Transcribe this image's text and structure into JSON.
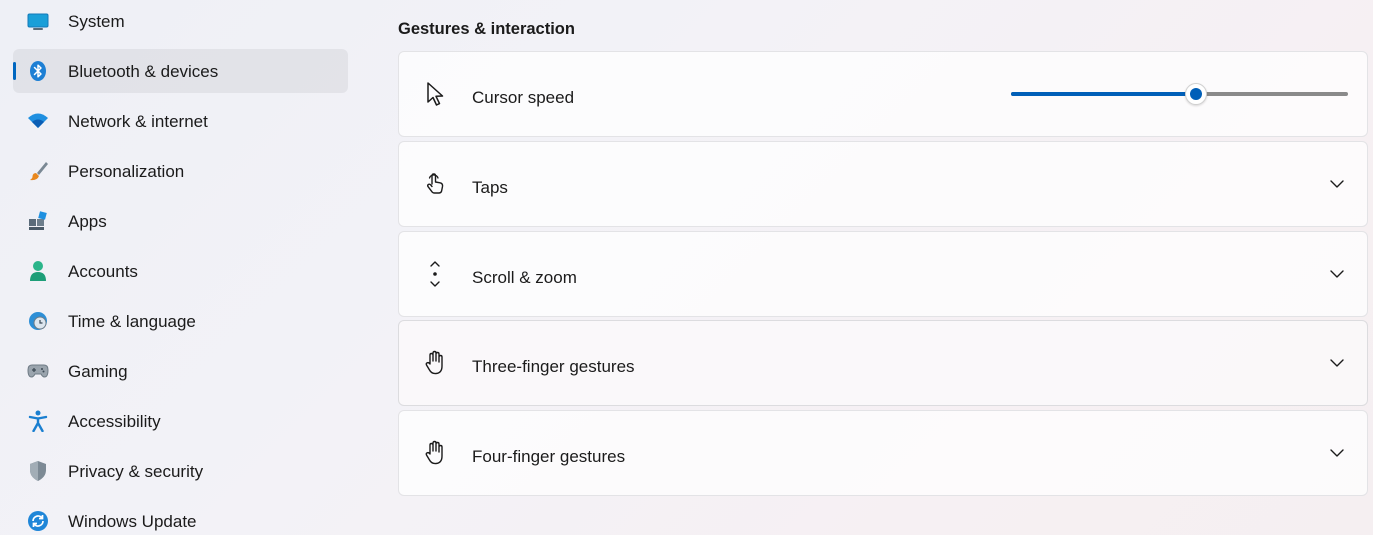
{
  "sidebar": {
    "items": [
      {
        "label": "System",
        "icon": "system-icon",
        "selected": false
      },
      {
        "label": "Bluetooth & devices",
        "icon": "bluetooth-icon",
        "selected": true
      },
      {
        "label": "Network & internet",
        "icon": "wifi-icon",
        "selected": false
      },
      {
        "label": "Personalization",
        "icon": "brush-icon",
        "selected": false
      },
      {
        "label": "Apps",
        "icon": "apps-icon",
        "selected": false
      },
      {
        "label": "Accounts",
        "icon": "account-icon",
        "selected": false
      },
      {
        "label": "Time & language",
        "icon": "time-language-icon",
        "selected": false
      },
      {
        "label": "Gaming",
        "icon": "gamepad-icon",
        "selected": false
      },
      {
        "label": "Accessibility",
        "icon": "accessibility-icon",
        "selected": false
      },
      {
        "label": "Privacy & security",
        "icon": "shield-icon",
        "selected": false
      },
      {
        "label": "Windows Update",
        "icon": "update-icon",
        "selected": false
      }
    ]
  },
  "main": {
    "section_title": "Gestures & interaction",
    "cards": [
      {
        "label": "Cursor speed",
        "icon": "cursor-icon",
        "control": "slider",
        "slider_value_percent": 55
      },
      {
        "label": "Taps",
        "icon": "tap-icon",
        "control": "chevron-down-icon"
      },
      {
        "label": "Scroll & zoom",
        "icon": "scroll-zoom-icon",
        "control": "chevron-down-icon"
      },
      {
        "label": "Three-finger gestures",
        "icon": "hand-icon",
        "control": "chevron-down-icon"
      },
      {
        "label": "Four-finger gestures",
        "icon": "hand-icon",
        "control": "chevron-down-icon"
      }
    ]
  },
  "colors": {
    "accent": "#005fb8",
    "selection_indicator": "#0067c0"
  }
}
